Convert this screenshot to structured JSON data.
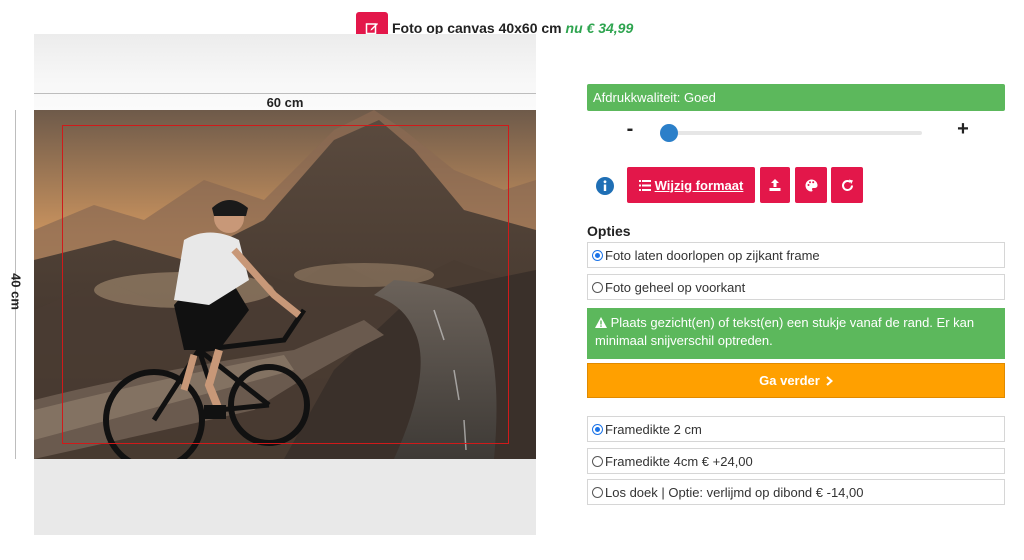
{
  "header": {
    "title": "Foto op canvas 40x60 cm",
    "price": "nu € 34,99"
  },
  "preview": {
    "width_label": "60 cm",
    "height_label": "40 cm"
  },
  "quality": {
    "label": "Afdrukkwaliteit: Goed"
  },
  "zoom": {
    "minus": "-",
    "plus": "+",
    "level": 0.0
  },
  "toolbar": {
    "format_label": "Wijzig formaat"
  },
  "options": {
    "title": "Opties",
    "wrap": [
      {
        "label": "Foto laten doorlopen op zijkant frame",
        "checked": true
      },
      {
        "label": "Foto geheel op voorkant",
        "checked": false
      }
    ],
    "warning": "Plaats gezicht(en) of tekst(en) een stukje vanaf de rand. Er kan minimaal snijverschil optreden.",
    "continue_label": "Ga verder",
    "frame": [
      {
        "label": "Framedikte 2 cm",
        "checked": true
      },
      {
        "label": "Framedikte 4cm € +24,00",
        "checked": false
      },
      {
        "label": "Los doek | Optie: verlijmd op dibond € -14,00",
        "checked": false
      }
    ]
  },
  "colors": {
    "accent": "#e3174a",
    "success": "#5cb85c",
    "cta": "#ffa000",
    "price": "#2ea44f",
    "crop_line": "#d01a1a"
  },
  "icons": [
    "edit-icon",
    "info-icon",
    "list-icon",
    "upload-icon",
    "palette-icon",
    "rotate-icon",
    "warning-icon",
    "chevron-right-icon"
  ]
}
